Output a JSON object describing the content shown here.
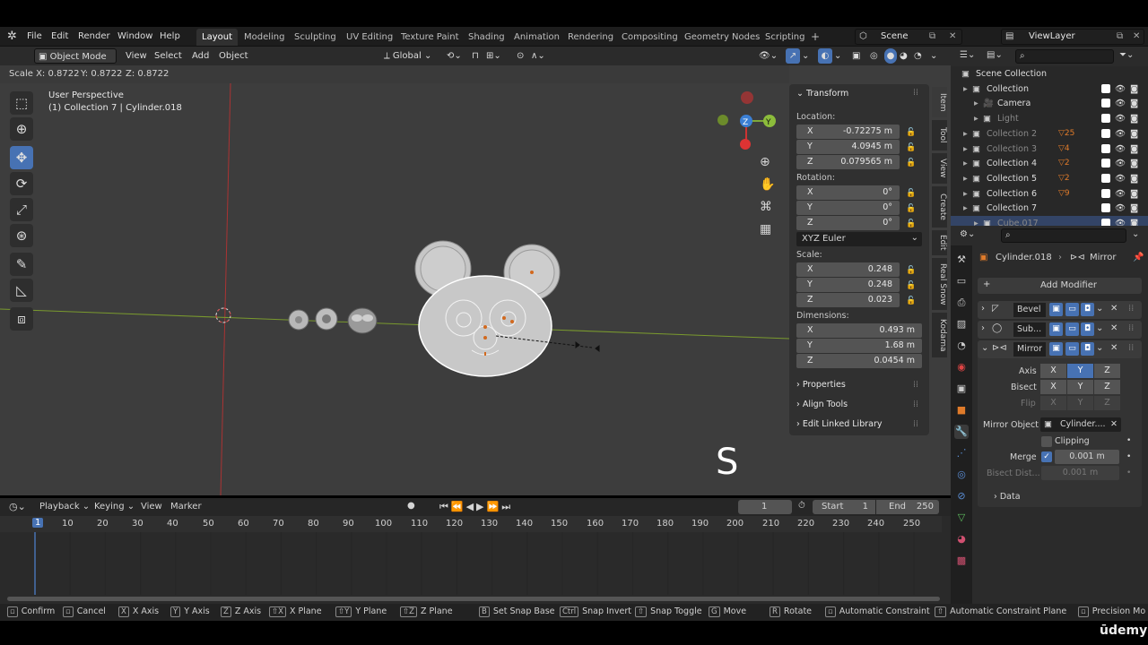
{
  "menubar": {
    "items": [
      "File",
      "Edit",
      "Render",
      "Window",
      "Help"
    ],
    "workspaces": [
      "Layout",
      "Modeling",
      "Sculpting",
      "UV Editing",
      "Texture Paint",
      "Shading",
      "Animation",
      "Rendering",
      "Compositing",
      "Geometry Nodes",
      "Scripting"
    ],
    "active_workspace": "Layout",
    "add_tab": "+",
    "scene": "Scene",
    "view_layer": "ViewLayer"
  },
  "viewport_header": {
    "mode": "Object Mode",
    "menus": [
      "View",
      "Select",
      "Add",
      "Object"
    ],
    "orientation": "Global"
  },
  "operator_status": {
    "scale_x": "Scale X: 0.8722",
    "scale_y": "Y: 0.8722",
    "scale_z": "Z: 0.8722"
  },
  "viewport": {
    "perspective": "User Perspective",
    "context": "(1) Collection 7 | Cylinder.018",
    "key_overlay": "S",
    "gizmo": {
      "z": "Z",
      "y": "Y"
    }
  },
  "npanel": {
    "transform_title": "Transform",
    "location_label": "Location:",
    "location": [
      {
        "axis": "X",
        "value": "-0.72275 m"
      },
      {
        "axis": "Y",
        "value": "4.0945 m"
      },
      {
        "axis": "Z",
        "value": "0.079565 m"
      }
    ],
    "rotation_label": "Rotation:",
    "rotation": [
      {
        "axis": "X",
        "value": "0°"
      },
      {
        "axis": "Y",
        "value": "0°"
      },
      {
        "axis": "Z",
        "value": "0°"
      }
    ],
    "rotation_mode": "XYZ Euler",
    "scale_label": "Scale:",
    "scale": [
      {
        "axis": "X",
        "value": "0.248"
      },
      {
        "axis": "Y",
        "value": "0.248"
      },
      {
        "axis": "Z",
        "value": "0.023"
      }
    ],
    "dimensions_label": "Dimensions:",
    "dimensions": [
      {
        "axis": "X",
        "value": "0.493 m"
      },
      {
        "axis": "Y",
        "value": "1.68 m"
      },
      {
        "axis": "Z",
        "value": "0.0454 m"
      }
    ],
    "sections": [
      "Properties",
      "Align Tools",
      "Edit Linked Library"
    ],
    "side_tabs": [
      "Item",
      "Tool",
      "View",
      "Create",
      "Edit",
      "Real Snow",
      "Kodama"
    ]
  },
  "timeline": {
    "menus": [
      "Playback",
      "Keying",
      "View",
      "Marker"
    ],
    "current_frame": "1",
    "start_label": "Start",
    "start": "1",
    "end_label": "End",
    "end": "250",
    "ticks": [
      "1",
      "10",
      "20",
      "30",
      "40",
      "50",
      "60",
      "70",
      "80",
      "90",
      "100",
      "110",
      "120",
      "130",
      "140",
      "150",
      "160",
      "170",
      "180",
      "190",
      "200",
      "210",
      "220",
      "230",
      "240",
      "250"
    ]
  },
  "outliner": {
    "items": [
      {
        "name": "Scene Collection",
        "indent": 0
      },
      {
        "name": "Collection",
        "indent": 1
      },
      {
        "name": "Camera",
        "indent": 2
      },
      {
        "name": "Light",
        "indent": 2
      },
      {
        "name": "Collection 2",
        "indent": 1,
        "badge": "25"
      },
      {
        "name": "Collection 3",
        "indent": 1,
        "badge": "4"
      },
      {
        "name": "Collection 4",
        "indent": 1,
        "badge": "2"
      },
      {
        "name": "Collection 5",
        "indent": 1,
        "badge": "2"
      },
      {
        "name": "Collection 6",
        "indent": 1,
        "badge": "9"
      },
      {
        "name": "Collection 7",
        "indent": 1
      },
      {
        "name": "Cube.017",
        "indent": 2
      }
    ]
  },
  "properties": {
    "object": "Cylinder.018",
    "modifier_context": "Mirror",
    "add_modifier": "Add Modifier",
    "modifiers": [
      "Bevel",
      "Sub...",
      "Mirror"
    ],
    "axis_label": "Axis",
    "bisect_label": "Bisect",
    "flip_label": "Flip",
    "axes": [
      "X",
      "Y",
      "Z"
    ],
    "mirror_object_label": "Mirror Object",
    "mirror_object": "Cylinder....",
    "clipping": "Clipping",
    "merge_label": "Merge",
    "merge_value": "0.001 m",
    "bisect_dist_label": "Bisect Dist...",
    "bisect_dist_value": "0.001 m",
    "data_label": "Data"
  },
  "statusbar": {
    "items": [
      {
        "key": "",
        "label": "Confirm"
      },
      {
        "key": "",
        "label": "Cancel"
      },
      {
        "key": "X",
        "label": "X Axis"
      },
      {
        "key": "Y",
        "label": "Y Axis"
      },
      {
        "key": "Z",
        "label": "Z Axis"
      },
      {
        "key": "⇧X",
        "label": "X Plane"
      },
      {
        "key": "⇧Y",
        "label": "Y Plane"
      },
      {
        "key": "⇧Z",
        "label": "Z Plane"
      },
      {
        "key": "B",
        "label": "Set Snap Base"
      },
      {
        "key": "Ctrl",
        "label": "Snap Invert"
      },
      {
        "key": "⇧",
        "label": "Snap Toggle"
      },
      {
        "key": "G",
        "label": "Move"
      },
      {
        "key": "R",
        "label": "Rotate"
      },
      {
        "key": "",
        "label": "Automatic Constraint"
      },
      {
        "key": "⇧",
        "label": "Automatic Constraint Plane"
      },
      {
        "key": "",
        "label": "Precision Mo"
      }
    ],
    "watermark": "ūdemy"
  }
}
